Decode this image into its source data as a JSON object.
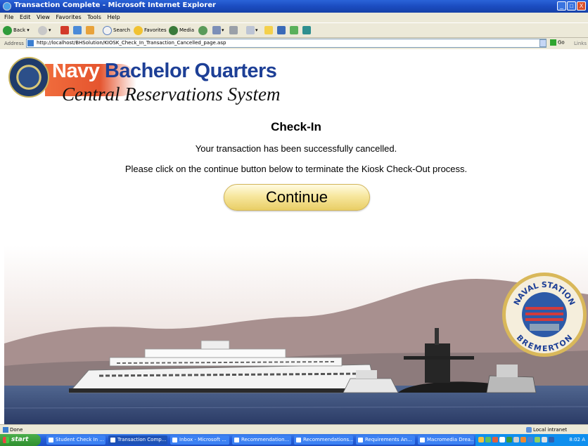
{
  "window": {
    "title": "Transaction Complete - Microsoft Internet Explorer",
    "buttons": [
      "_",
      "□",
      "X"
    ]
  },
  "menu": [
    "File",
    "Edit",
    "View",
    "Favorites",
    "Tools",
    "Help"
  ],
  "toolbar": {
    "back": "Back",
    "search": "Search",
    "favorites": "Favorites",
    "media": "Media"
  },
  "address": {
    "label": "Address",
    "url": "http://localhost/BHSolution/KIOSK_Check_In_Transaction_Cancelled_page.asp",
    "go": "Go",
    "links": "Links"
  },
  "banner": {
    "line1_a": "Navy",
    "line1_b": " Bachelor Quarters",
    "line2": "Central Reservations System"
  },
  "page": {
    "heading": "Check-In",
    "message1": "Your transaction has been successfully cancelled.",
    "message2": "Please click on the continue button below to terminate the Kiosk Check-Out process.",
    "continue_label": "Continue"
  },
  "seal_right": {
    "top_text": "NAVAL STATION",
    "bottom_text": "BREMERTON"
  },
  "status": {
    "left": "Done",
    "zone": "Local intranet"
  },
  "taskbar": {
    "start": "start",
    "items": [
      "Student Check In ...",
      "Transaction Comp...",
      "Inbox - Microsoft ...",
      "Recommendation...",
      "Recommendations...",
      "Requirements An...",
      "Macromedia Drea..."
    ],
    "active_index": 1,
    "clock": "8:02 A"
  },
  "colors": {
    "title_blue": "#1b4cc0",
    "banner_blue": "#1d3f96",
    "banner_orange": "#e5552f",
    "button_gold": "#f7e79e"
  }
}
